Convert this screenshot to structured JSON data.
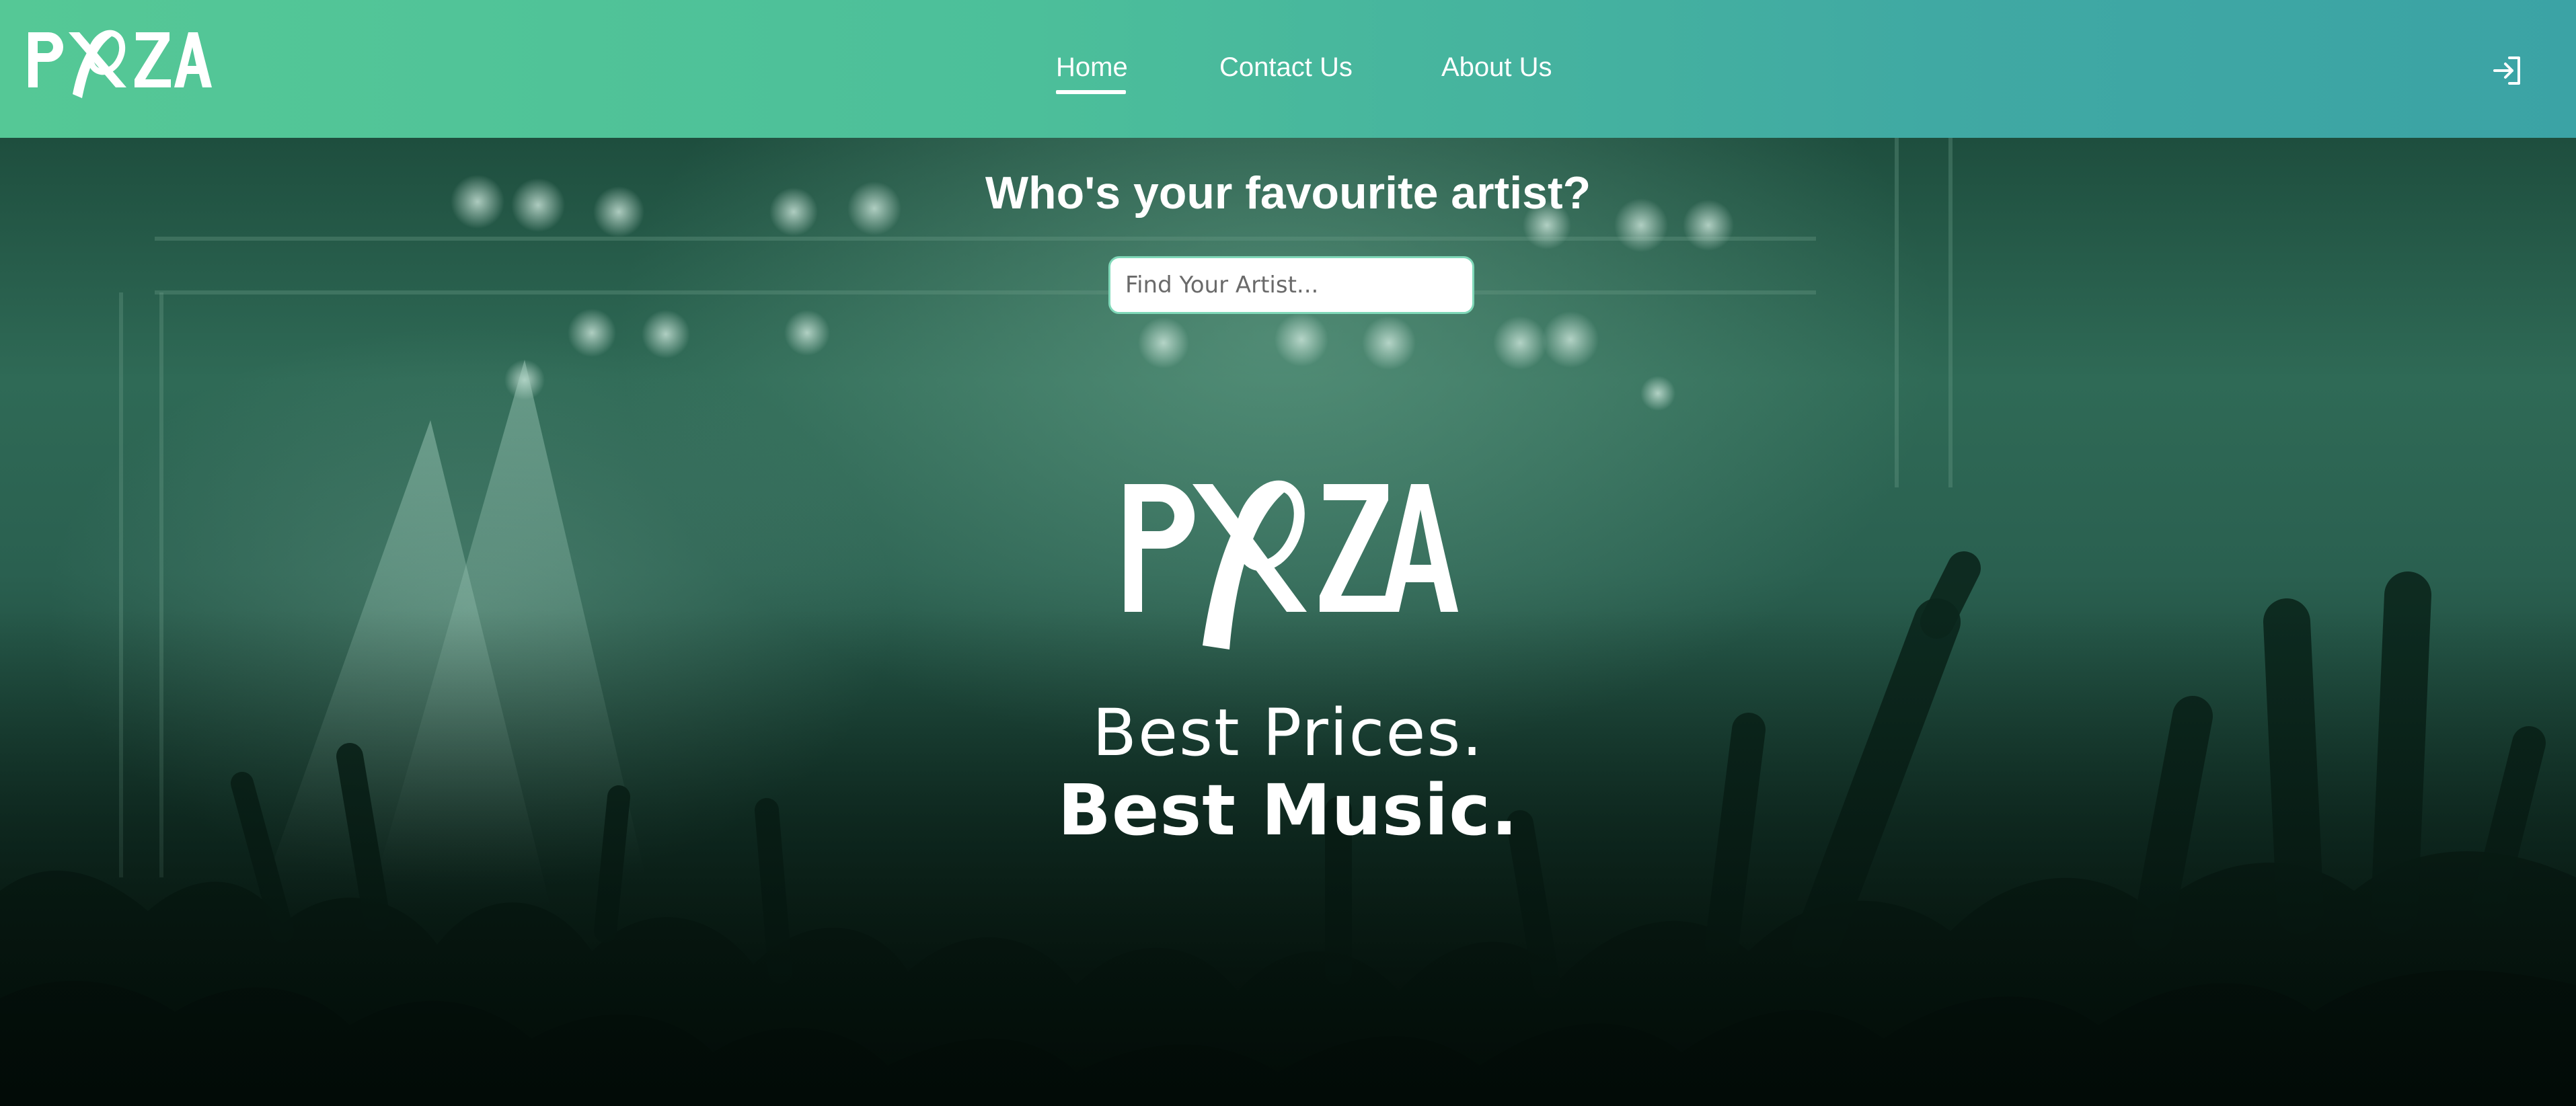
{
  "brand": {
    "logo_text": "PXZA"
  },
  "nav": {
    "items": [
      {
        "label": "Home",
        "active": true
      },
      {
        "label": "Contact Us",
        "active": false
      },
      {
        "label": "About Us",
        "active": false
      }
    ],
    "login_icon": "sign-in-icon"
  },
  "hero": {
    "title": "Who's your favourite artist?",
    "search": {
      "placeholder": "Find Your Artist...",
      "value": ""
    },
    "tagline_line1": "Best Prices.",
    "tagline_line2": "Best Music."
  },
  "colors": {
    "nav_gradient_start": "#55c896",
    "nav_gradient_end": "#3ba3a5",
    "hero_tint": "#2f6a56",
    "text": "#ffffff",
    "search_border": "#7fd8b8"
  }
}
